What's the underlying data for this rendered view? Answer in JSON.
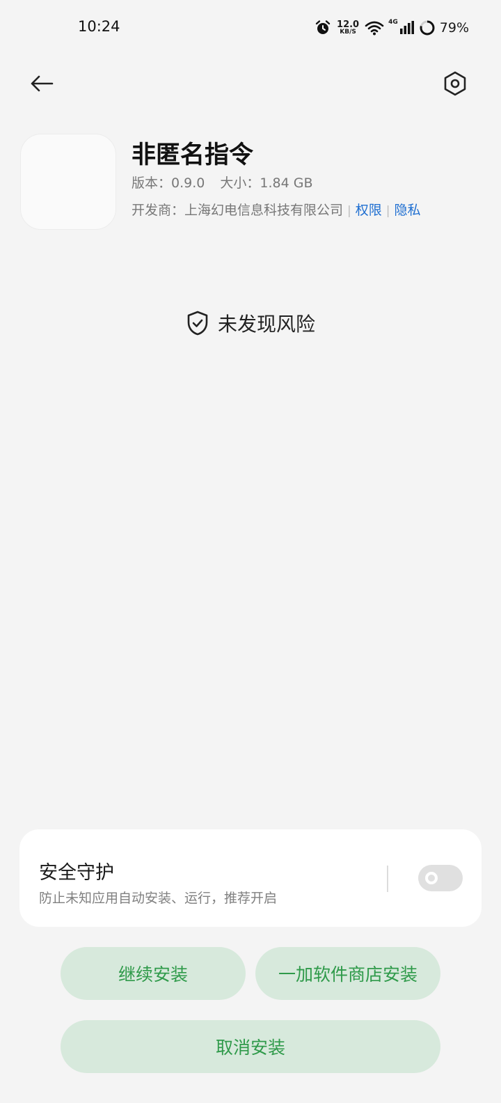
{
  "status_bar": {
    "time": "10:24",
    "net_speed_value": "12.0",
    "net_speed_unit": "KB/S",
    "signal_type": "4G",
    "battery_percent": "79%",
    "battery_level": 0.79,
    "icons": [
      "alarm-icon",
      "wifi-icon",
      "cell-signal-icon",
      "battery-ring-icon"
    ]
  },
  "header": {
    "back_icon": "arrow-left-icon",
    "settings_icon": "hexagon-settings-icon"
  },
  "app": {
    "name": "非匿名指令",
    "version_label": "版本：",
    "version": "0.9.0",
    "size_label": "大小：",
    "size": "1.84 GB",
    "developer_label": "开发商：",
    "developer": "上海幻电信息科技有限公司",
    "separator": "|",
    "permissions_link": "权限",
    "privacy_link": "隐私"
  },
  "risk": {
    "icon": "shield-check-icon",
    "text": "未发现风险"
  },
  "security": {
    "title": "安全守护",
    "description": "防止未知应用自动安装、运行，推荐开启",
    "toggle_on": false
  },
  "buttons": {
    "continue": "继续安装",
    "store_install": "一加软件商店安装",
    "cancel": "取消安装"
  },
  "colors": {
    "background": "#f4f4f4",
    "button_bg": "#d7e9dc",
    "button_text": "#2f9a4a",
    "link": "#1f6fd1"
  }
}
